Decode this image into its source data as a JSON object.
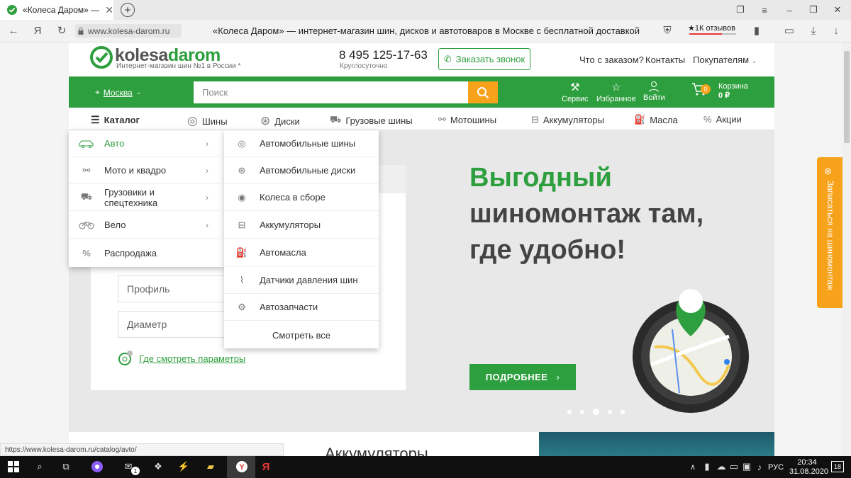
{
  "browser": {
    "tab_title": "«Колеса Даром» — ин",
    "url_display": "www.kolesa-darom.ru",
    "page_title": "«Колеса Даром» — интернет-магазин шин, дисков и автотоваров в Москве с бесплатной доставкой",
    "reviews_badge": "★1К отзывов",
    "status_url": "https://www.kolesa-darom.ru/catalog/avto/"
  },
  "header": {
    "logo_part1": "kolesa",
    "logo_part2": "darom",
    "tagline": "Интернет-магазин шин №1 в России *",
    "phone": "8 495 125-17-63",
    "phone_note": "Круглосуточно",
    "callback_label": "Заказать звонок",
    "links": [
      "Что с заказом?",
      "Контакты",
      "Покупателям"
    ]
  },
  "greenbar": {
    "city": "Москва",
    "search_placeholder": "Поиск",
    "service": "Сервис",
    "favorites": "Избранное",
    "login": "Войти",
    "cart_label": "Корзина",
    "cart_total": "0 ₽",
    "cart_count": "0"
  },
  "catnav": {
    "catalog": "Каталог",
    "items": [
      "Шины",
      "Диски",
      "Грузовые шины",
      "Мотошины",
      "Аккумуляторы",
      "Масла",
      "Акции"
    ]
  },
  "menu": {
    "left": [
      "Авто",
      "Мото и квадро",
      "Грузовики и спецтехника",
      "Вело",
      "Распродажа"
    ],
    "right": [
      "Автомобильные шины",
      "Автомобильные диски",
      "Колеса в сборе",
      "Аккумуляторы",
      "Автомасла",
      "Датчики давления шин",
      "Автозапчасти"
    ],
    "view_all": "Смотреть все"
  },
  "filter": {
    "profile_placeholder": "Профиль",
    "diameter_placeholder": "Диаметр",
    "params_link": "Где смотреть параметры"
  },
  "hero": {
    "title_green": "Выгодный",
    "title_rest": "шиномонтаж там,\nгде удобно!",
    "button": "ПОДРОБНЕЕ",
    "slides": 5,
    "active_slide": 3
  },
  "side_tab": "Записаться на шиномонтаж",
  "bottom_heading": "Аккумуляторы",
  "taskbar": {
    "lang": "РУС",
    "time": "20:34",
    "date": "31.08.2020",
    "notifications": "18",
    "mail_badge": "1"
  },
  "colors": {
    "brand_green": "#2e9f3e",
    "accent_orange": "#f7a21b"
  }
}
